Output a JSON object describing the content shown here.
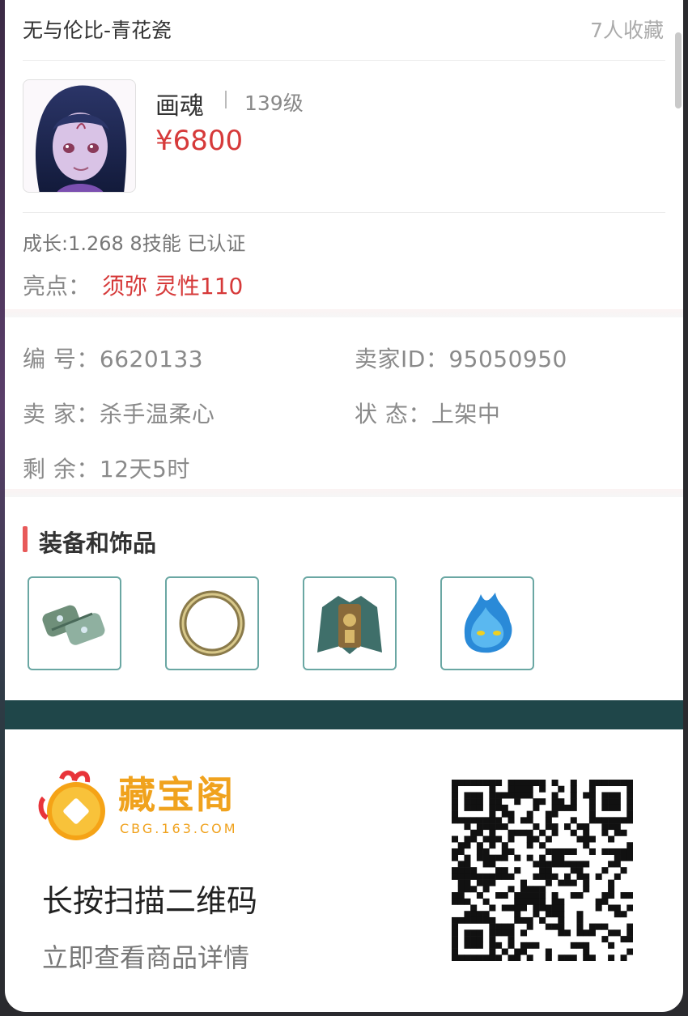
{
  "header": {
    "title": "无与伦比-青花瓷",
    "favorites": "7人收藏"
  },
  "pet": {
    "name": "画魂",
    "level": "139级",
    "price": "¥6800",
    "growth_line": "成长:1.268 8技能 已认证",
    "highlight_label": "亮点：",
    "highlight_value": "须弥 灵性110"
  },
  "info": {
    "id_label": "编  号：",
    "id_value": "6620133",
    "seller_id_label": "卖家ID：",
    "seller_id_value": "95050950",
    "seller_label": "卖  家：",
    "seller_value": "杀手温柔心",
    "status_label": "状  态：",
    "status_value": "上架中",
    "remaining_label": "剩  余：",
    "remaining_value": "12天5时"
  },
  "equipment": {
    "title": "装备和饰品",
    "items": [
      {
        "icon": "bracer-icon"
      },
      {
        "icon": "ring-icon"
      },
      {
        "icon": "armor-icon"
      },
      {
        "icon": "blue-flame-icon"
      }
    ]
  },
  "footer": {
    "logo_title": "藏宝阁",
    "logo_url": "CBG.163.COM",
    "cta_primary": "长按扫描二维码",
    "cta_secondary": "立即查看商品详情"
  },
  "colors": {
    "accent_red": "#d63a3a",
    "teal": "#1f4649",
    "gold": "#f0a21d"
  }
}
